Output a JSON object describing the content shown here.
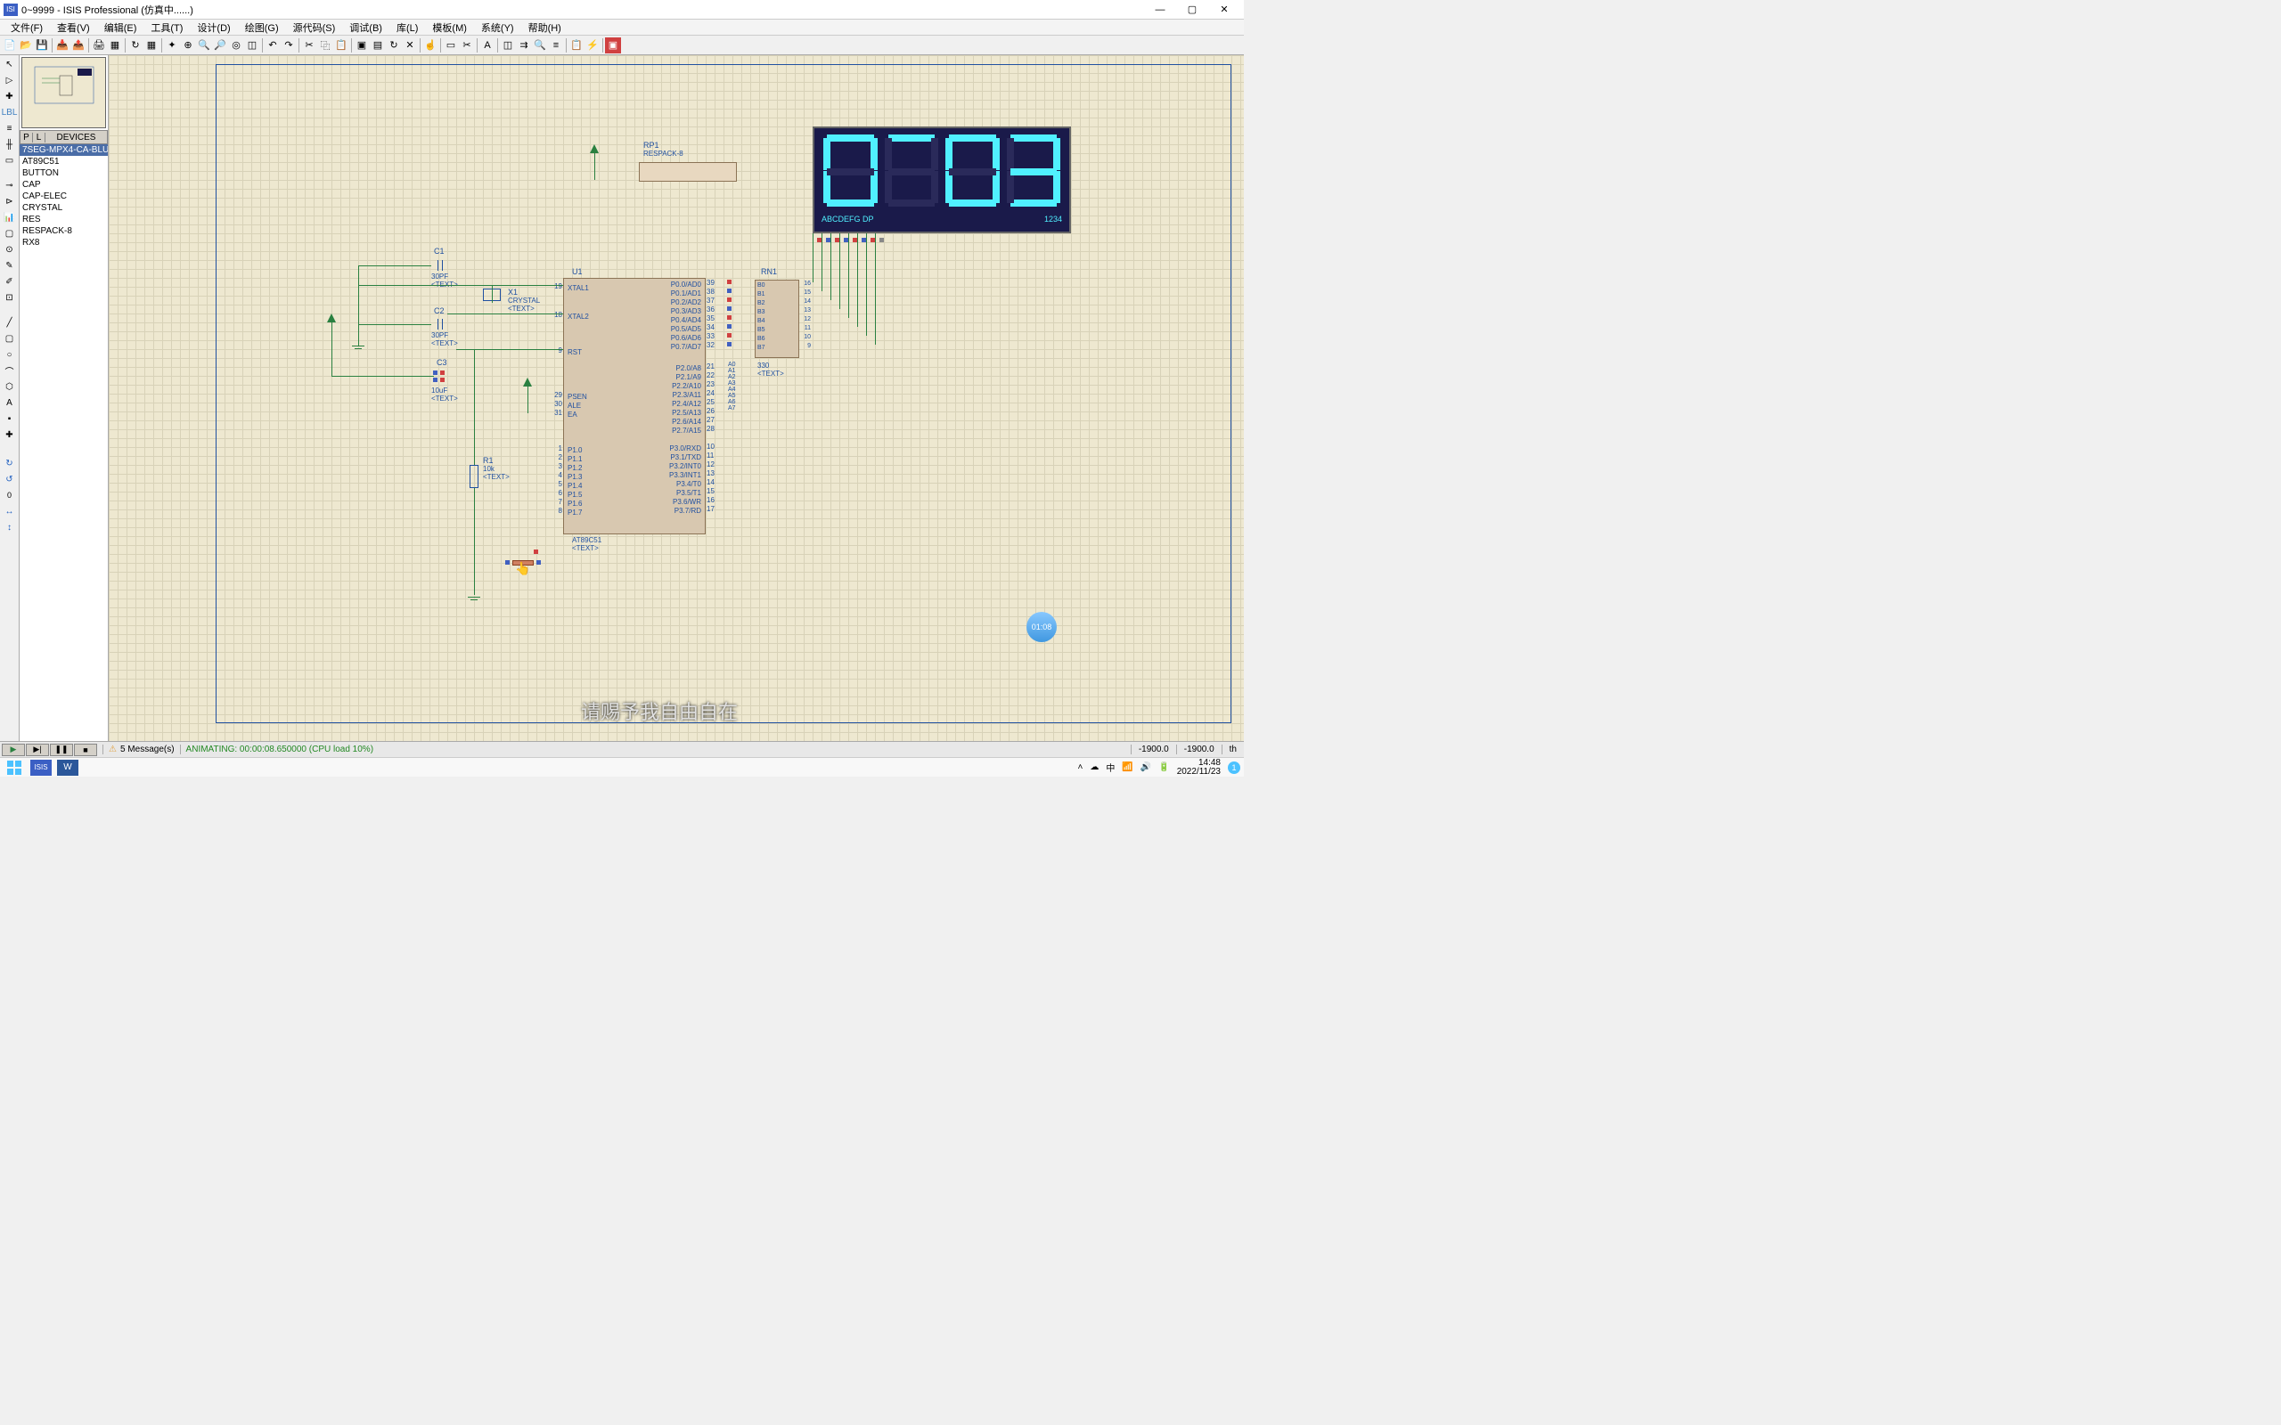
{
  "titlebar": {
    "icon_text": "ISI",
    "title": "0~9999 - ISIS Professional (仿真中......)"
  },
  "menubar": {
    "items": [
      "文件(F)",
      "查看(V)",
      "编辑(E)",
      "工具(T)",
      "设计(D)",
      "绘图(G)",
      "源代码(S)",
      "调试(B)",
      "库(L)",
      "模板(M)",
      "系统(Y)",
      "帮助(H)"
    ]
  },
  "device_panel": {
    "p_btn": "P",
    "l_btn": "L",
    "header": "DEVICES",
    "items": [
      "7SEG-MPX4-CA-BLUE",
      "AT89C51",
      "BUTTON",
      "CAP",
      "CAP-ELEC",
      "CRYSTAL",
      "RES",
      "RESPACK-8",
      "RX8"
    ],
    "selected_index": 0
  },
  "schematic": {
    "rp1": {
      "ref": "RP1",
      "value": "RESPACK-8"
    },
    "u1": {
      "ref": "U1",
      "part": "AT89C51",
      "text": "<TEXT>",
      "pins_left_inner": [
        "XTAL1",
        "XTAL2",
        "RST",
        "PSEN",
        "ALE",
        "EA",
        "P1.0",
        "P1.1",
        "P1.2",
        "P1.3",
        "P1.4",
        "P1.5",
        "P1.6",
        "P1.7"
      ],
      "pins_left_num": [
        "19",
        "18",
        "9",
        "29",
        "30",
        "31",
        "1",
        "2",
        "3",
        "4",
        "5",
        "6",
        "7",
        "8"
      ],
      "pins_right_inner": [
        "P0.0/AD0",
        "P0.1/AD1",
        "P0.2/AD2",
        "P0.3/AD3",
        "P0.4/AD4",
        "P0.5/AD5",
        "P0.6/AD6",
        "P0.7/AD7",
        "P2.0/A8",
        "P2.1/A9",
        "P2.2/A10",
        "P2.3/A11",
        "P2.4/A12",
        "P2.5/A13",
        "P2.6/A14",
        "P2.7/A15",
        "P3.0/RXD",
        "P3.1/TXD",
        "P3.2/INT0",
        "P3.3/INT1",
        "P3.4/T0",
        "P3.5/T1",
        "P3.6/WR",
        "P3.7/RD"
      ],
      "pins_right_num": [
        "39",
        "38",
        "37",
        "36",
        "35",
        "34",
        "33",
        "32",
        "21",
        "22",
        "23",
        "24",
        "25",
        "26",
        "27",
        "28",
        "10",
        "11",
        "12",
        "13",
        "14",
        "15",
        "16",
        "17"
      ]
    },
    "rn1": {
      "ref": "RN1",
      "value": "330",
      "text": "<TEXT>",
      "a_labels": [
        "A0",
        "A1",
        "A2",
        "A3",
        "A4",
        "A5",
        "A6",
        "A7"
      ],
      "b_labels": [
        "B0",
        "B1",
        "B2",
        "B3",
        "B4",
        "B5",
        "B6",
        "B7"
      ],
      "pins_right": [
        "16",
        "15",
        "14",
        "13",
        "12",
        "11",
        "10",
        "9"
      ]
    },
    "c1": {
      "ref": "C1",
      "value": "30PF",
      "text": "<TEXT>"
    },
    "c2": {
      "ref": "C2",
      "value": "30PF",
      "text": "<TEXT>"
    },
    "c3": {
      "ref": "C3",
      "value": "10uF",
      "text": "<TEXT>"
    },
    "x1": {
      "ref": "X1",
      "value": "CRYSTAL",
      "text": "<TEXT>"
    },
    "r1": {
      "ref": "R1",
      "value": "10k",
      "text": "<TEXT>"
    },
    "display": {
      "footer_left": "ABCDEFG DP",
      "footer_right": "1234",
      "digits": [
        "0",
        "sep",
        "0",
        "3"
      ]
    }
  },
  "statusbar": {
    "messages": "5 Message(s)",
    "animating": "ANIMATING: 00:00:08.650000 (CPU load 10%)",
    "coord_x": "-1900.0",
    "coord_y": "-1900.0",
    "unit": "th"
  },
  "taskbar": {
    "tray": {
      "ime": "中",
      "time": "14:48",
      "date": "2022/11/23"
    }
  },
  "overlay": {
    "video_time": "01:08",
    "subtitle": "请赐予我自由自在"
  }
}
